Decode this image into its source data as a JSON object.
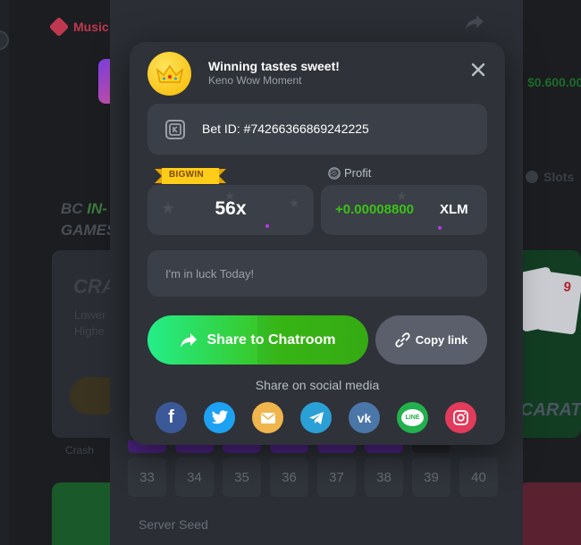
{
  "background": {
    "music_label": "Music",
    "balance": "$0.600.00",
    "slots_label": "Slots",
    "heading_line1_prefix": "BC ",
    "heading_line1_highlight": "IN-",
    "heading_line2": "GAMES",
    "card_title": "CRA",
    "card_line1": "Lower",
    "card_line2": "Highe",
    "card_button": "P",
    "crash_label": "Crash",
    "card_brand": "CARAT",
    "card_number": "9",
    "numbers": [
      "33",
      "34",
      "35",
      "36",
      "37",
      "38",
      "39",
      "40"
    ],
    "server_seed_label": "Server Seed"
  },
  "modal": {
    "title": "Winning tastes sweet!",
    "subtitle": "Keno Wow Moment",
    "bet_label": "Bet ID: #74266366869242225",
    "bigwin_badge": "BIGWIN",
    "multiplier": "56x",
    "profit_label": "Profit",
    "profit_amount": "+0.00008800",
    "profit_currency": "XLM",
    "message_placeholder": "I'm in luck Today!",
    "share_chat_label": "Share to Chatroom",
    "copy_link_label": "Copy link",
    "social_heading": "Share on social media",
    "social": [
      {
        "name": "facebook",
        "glyph": "f",
        "color": "#3b5998"
      },
      {
        "name": "twitter",
        "glyph": "",
        "color": "#1da1f2"
      },
      {
        "name": "email",
        "glyph": "",
        "color": "#f0b54c"
      },
      {
        "name": "telegram",
        "glyph": "",
        "color": "#2aa0d6"
      },
      {
        "name": "vk",
        "glyph": "vk",
        "color": "#4a76a8"
      },
      {
        "name": "line",
        "glyph": "LINE",
        "color": "#22b14c"
      },
      {
        "name": "instagram",
        "glyph": "",
        "color": "#e23b5b"
      }
    ]
  },
  "colors": {
    "accent_green": "#3bc117",
    "modal_bg": "#2f3238",
    "field_bg": "#3b3f47"
  }
}
